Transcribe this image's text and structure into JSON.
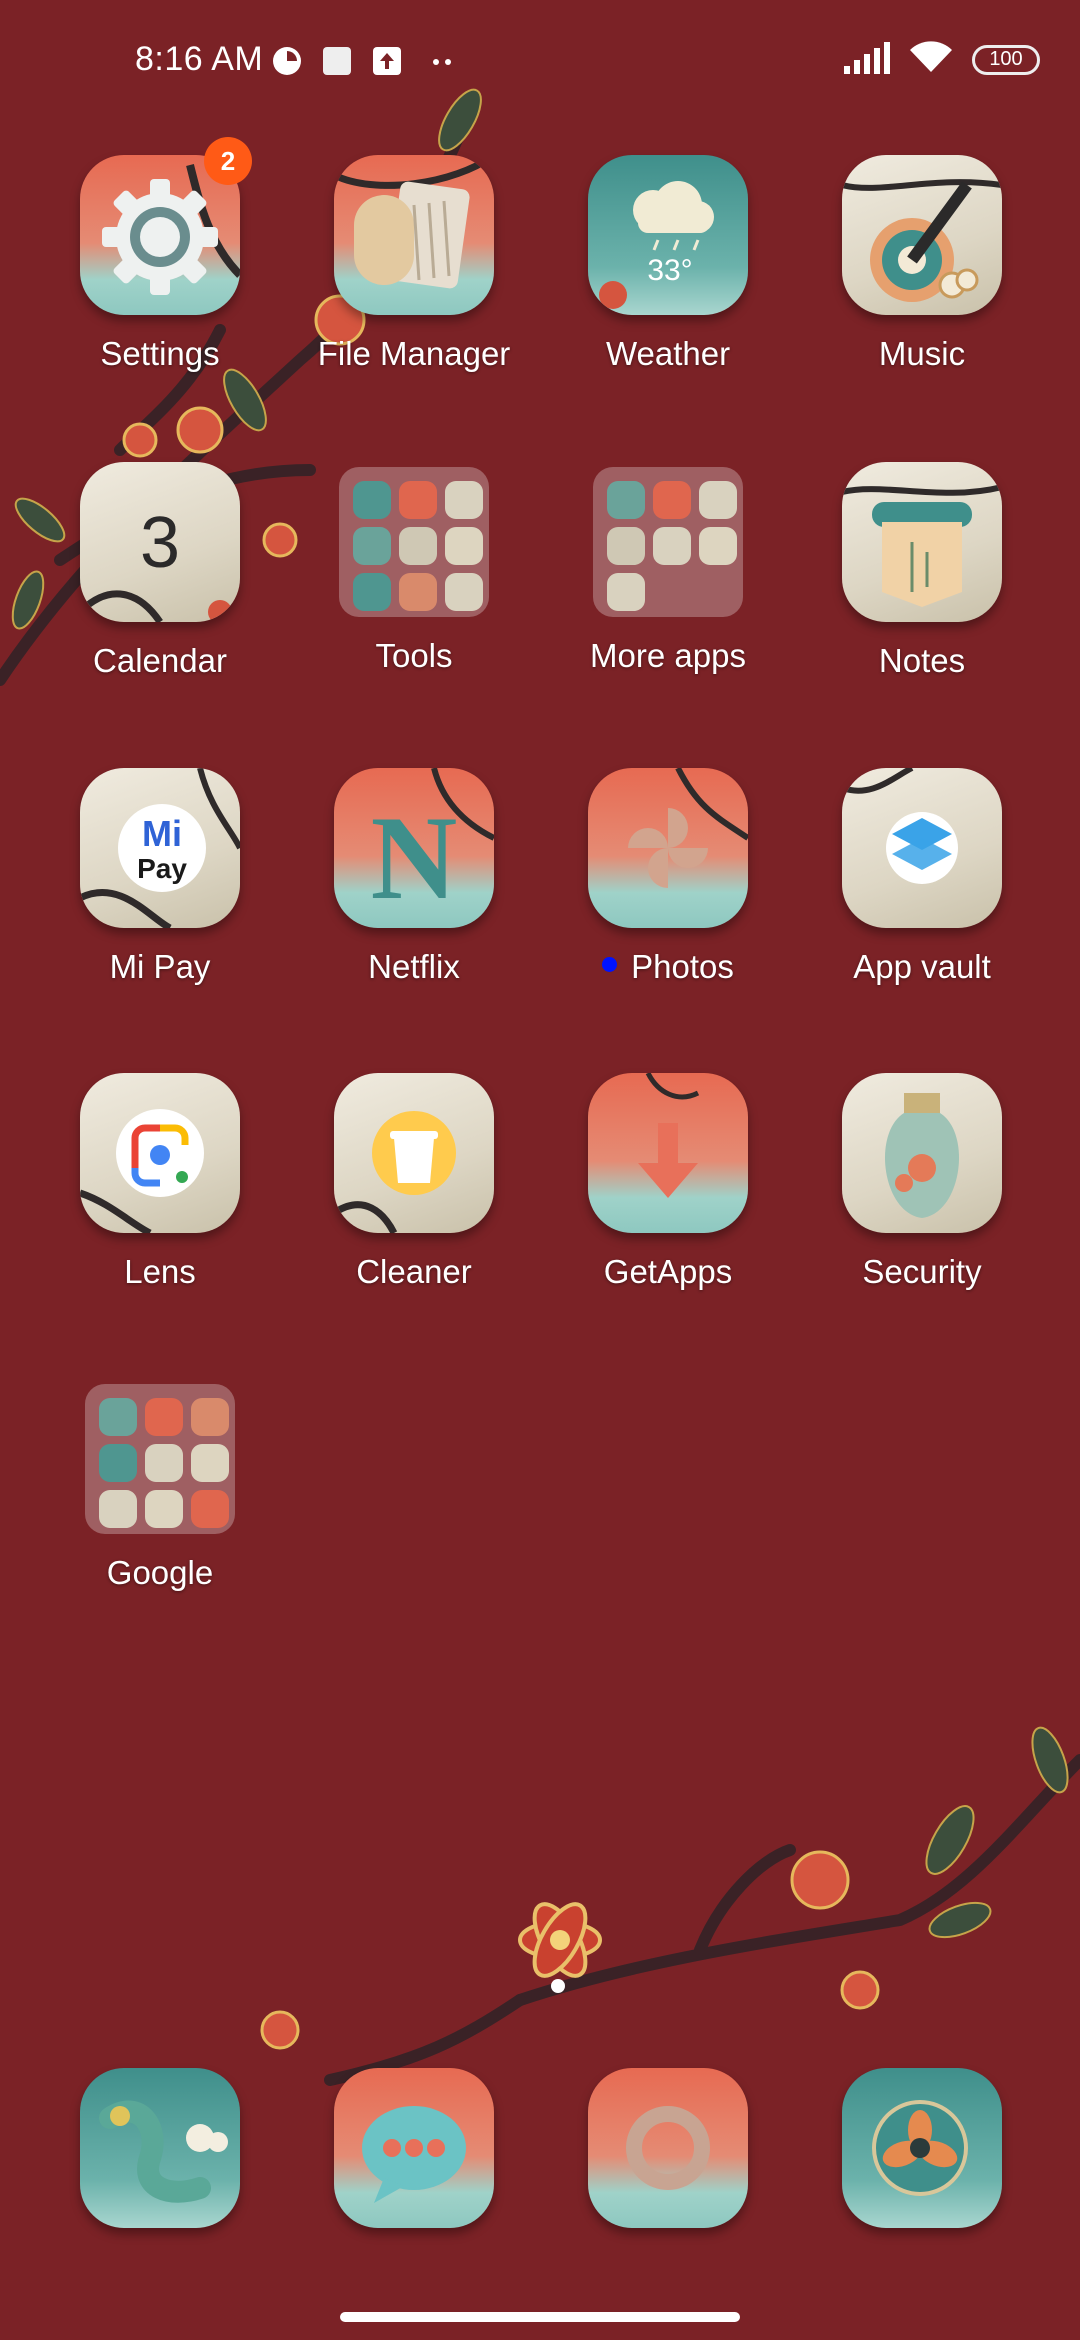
{
  "status_bar": {
    "time": "8:16 AM",
    "icons": [
      "pie-icon",
      "stop-icon",
      "upload-icon",
      "more-dots-icon"
    ],
    "right_icons": [
      "signal-icon",
      "wifi-icon"
    ],
    "battery": "100"
  },
  "apps": [
    {
      "label": "Settings",
      "icon": "gear-icon",
      "badge": "2"
    },
    {
      "label": "File Manager",
      "icon": "scroll-folder-icon"
    },
    {
      "label": "Weather",
      "icon": "cloud-icon",
      "temp": "33°"
    },
    {
      "label": "Music",
      "icon": "guitar-icon"
    },
    {
      "label": "Calendar",
      "icon": "calendar-icon",
      "day": "3"
    },
    {
      "label": "Tools",
      "icon": "folder-icon"
    },
    {
      "label": "More apps",
      "icon": "folder-icon"
    },
    {
      "label": "Notes",
      "icon": "scroll-icon"
    },
    {
      "label": "Mi Pay",
      "icon": "mi-pay-icon",
      "text1": "Mi",
      "text2": "Pay"
    },
    {
      "label": "Netflix",
      "icon": "netflix-icon",
      "text1": "N"
    },
    {
      "label": "Photos",
      "icon": "pinwheel-icon"
    },
    {
      "label": "App vault",
      "icon": "layers-icon"
    },
    {
      "label": "Lens",
      "icon": "lens-icon"
    },
    {
      "label": "Cleaner",
      "icon": "trash-icon"
    },
    {
      "label": "GetApps",
      "icon": "download-arrow-icon"
    },
    {
      "label": "Security",
      "icon": "vase-icon"
    },
    {
      "label": "Google",
      "icon": "folder-icon"
    }
  ],
  "dock": [
    {
      "name": "phone-dragon-icon"
    },
    {
      "name": "messages-icon"
    },
    {
      "name": "browser-ring-icon"
    },
    {
      "name": "camera-icon"
    }
  ],
  "colors": {
    "wallpaper": "#7b2226",
    "badge": "#ff5a16",
    "new_dot": "#0013ff"
  }
}
